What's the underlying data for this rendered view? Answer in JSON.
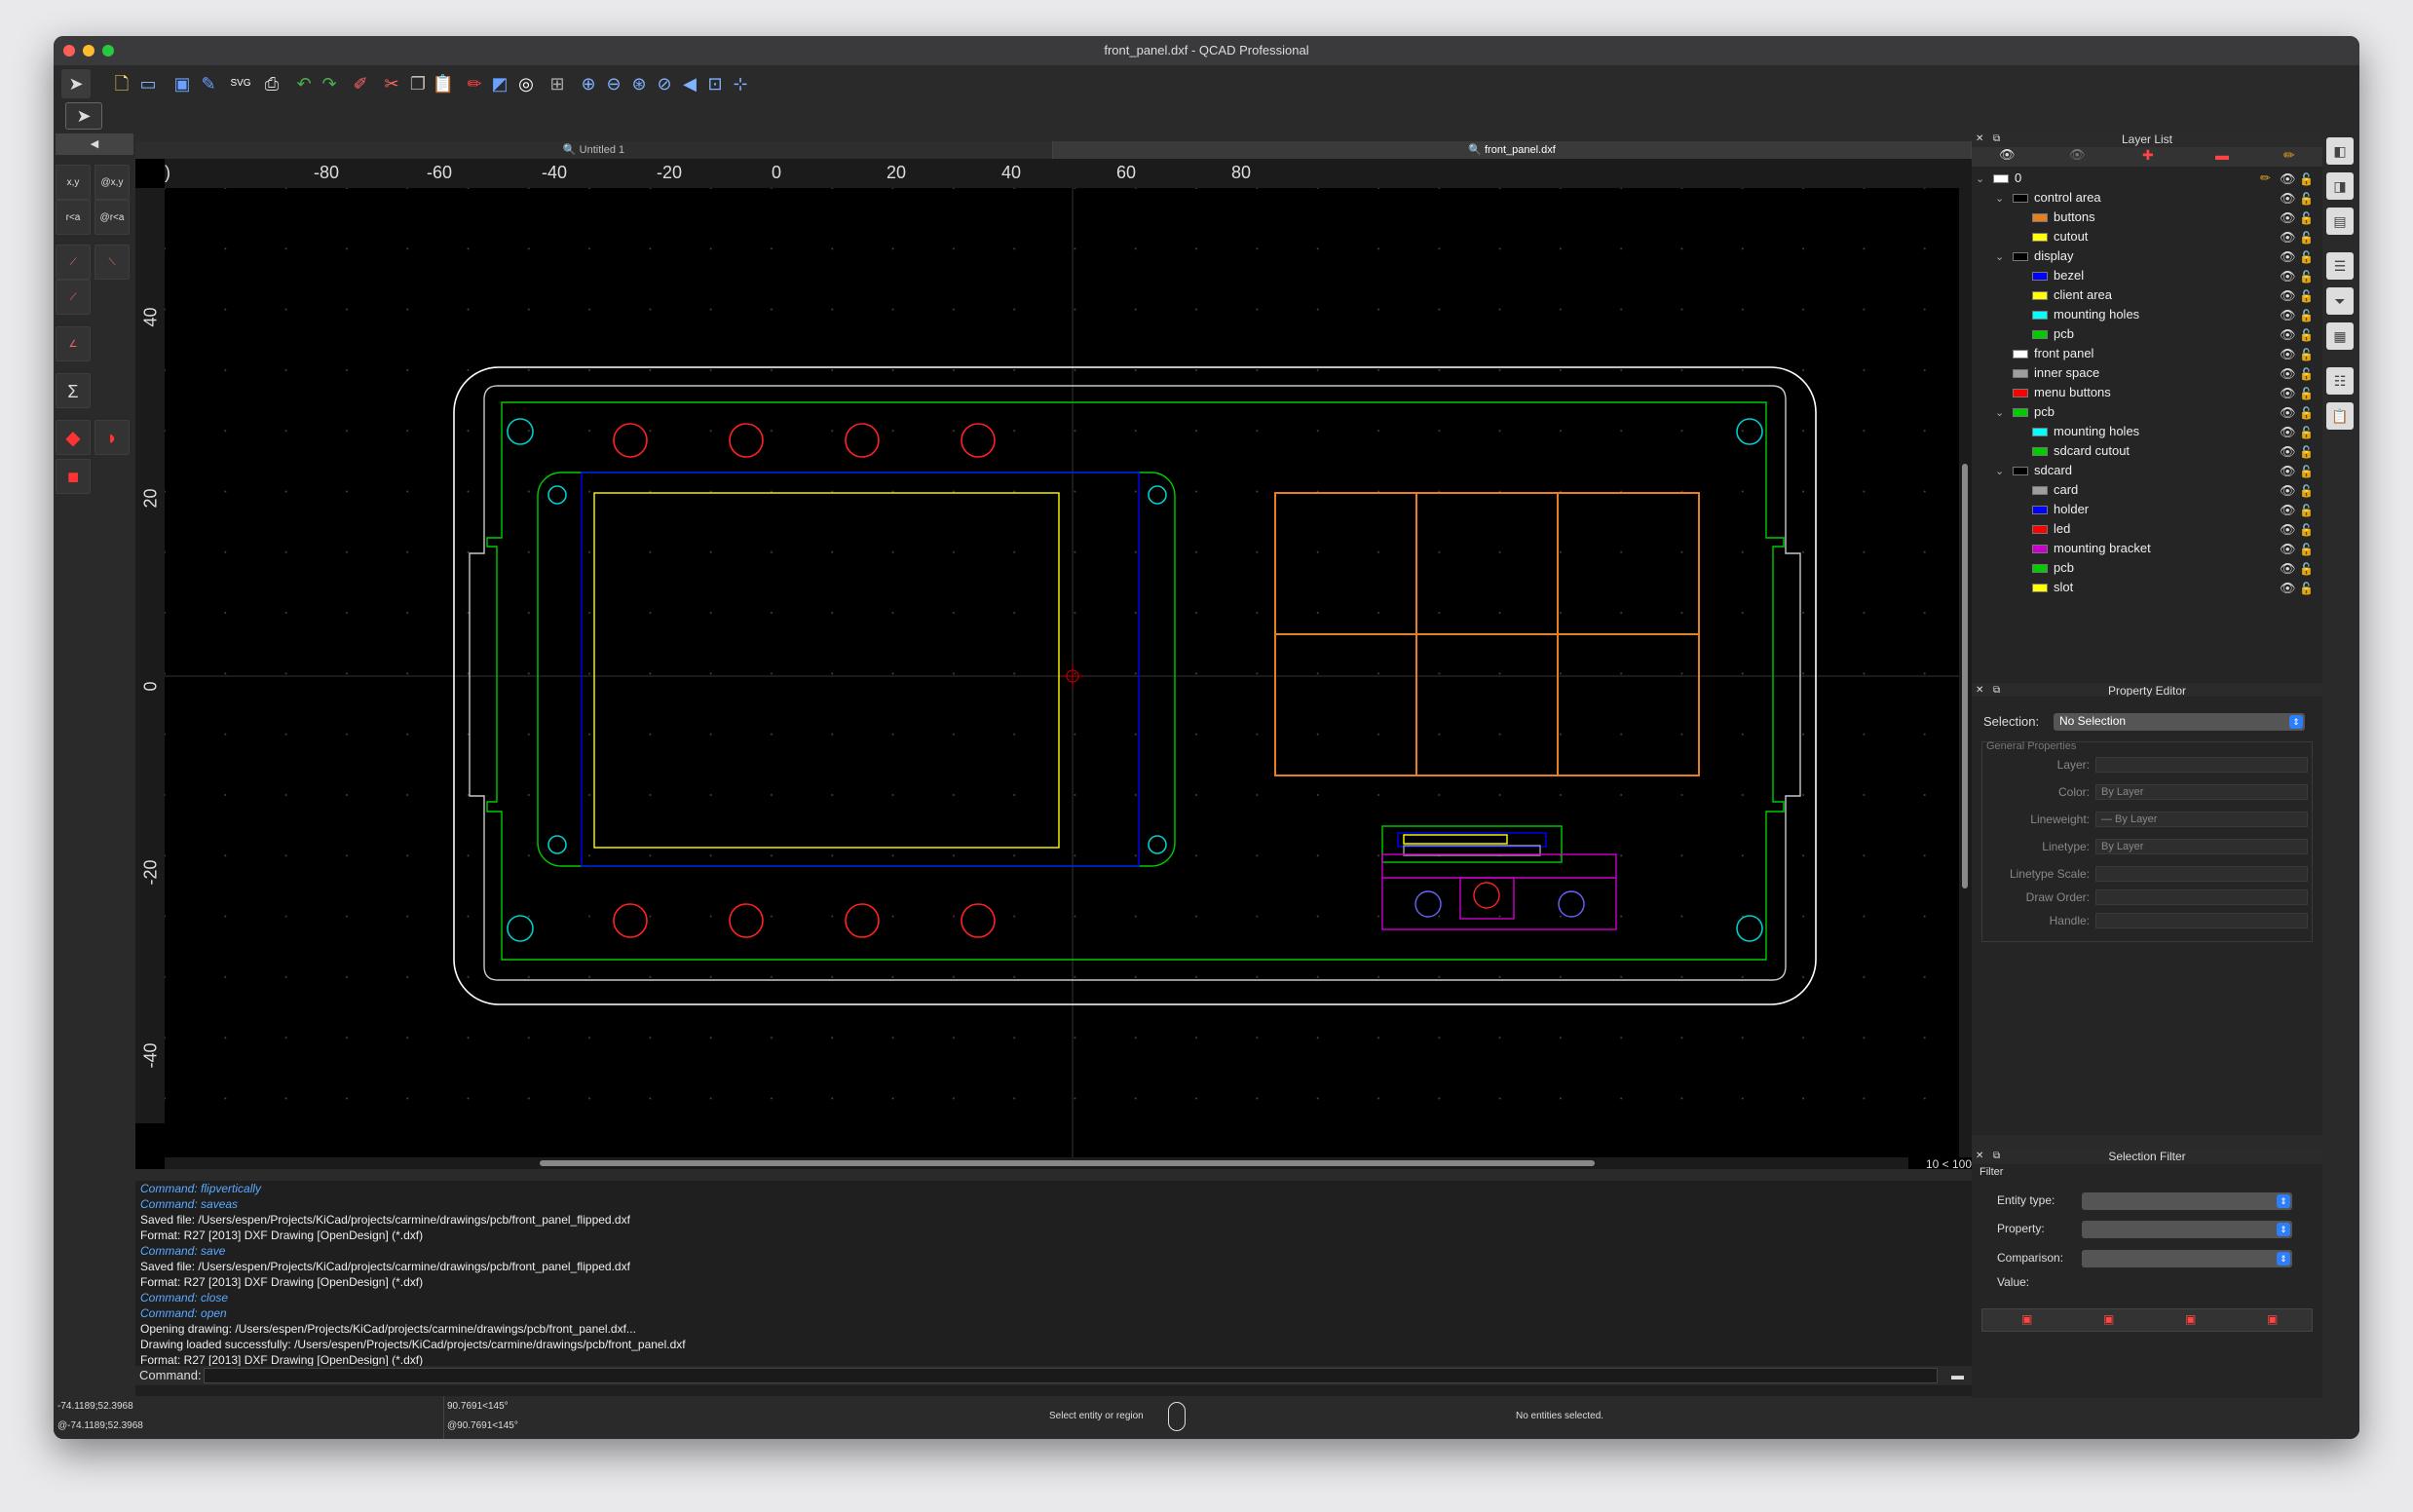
{
  "window": {
    "title": "front_panel.dxf - QCAD Professional"
  },
  "toolbar": {
    "icons": [
      "pointer-icon",
      "new-file-icon",
      "open-icon",
      "save-icon",
      "edit-icon",
      "svg-export-icon",
      "print-icon",
      "undo-icon",
      "redo-icon",
      "eraser-icon",
      "cut-icon",
      "copy-icon",
      "paste-icon",
      "pen-icon",
      "block-icon",
      "circle-tool-icon",
      "grid-icon",
      "zoom-in-icon",
      "zoom-out-icon",
      "zoom-auto-icon",
      "zoom-previous-icon",
      "zoom-pan-icon",
      "zoom-window-icon",
      "zoom-selection-icon"
    ],
    "svg_label": "SVG"
  },
  "left_tools": {
    "xy": "x,y",
    "rel_xy": "@x,y",
    "polar": "r<a",
    "rel_polar": "@r<a",
    "sigma": "Σ"
  },
  "tabs": [
    {
      "label": "Untitled 1",
      "active": false
    },
    {
      "label": "front_panel.dxf",
      "active": true
    }
  ],
  "rulers": {
    "horizontal": [
      "-80",
      "-60",
      "-40",
      "-20",
      "0",
      "20",
      "40",
      "60",
      "80"
    ],
    "vertical": [
      "40",
      "20",
      "0",
      "-20",
      "-40"
    ]
  },
  "zoom_label": "10 < 100",
  "console": {
    "lines": [
      {
        "text": "Command: flipvertically",
        "cmd": true
      },
      {
        "text": "Command: saveas",
        "cmd": true
      },
      {
        "text": "Saved file: /Users/espen/Projects/KiCad/projects/carmine/drawings/pcb/front_panel_flipped.dxf",
        "cmd": false
      },
      {
        "text": "Format: R27 [2013] DXF Drawing [OpenDesign] (*.dxf)",
        "cmd": false
      },
      {
        "text": "Command: save",
        "cmd": true
      },
      {
        "text": "Saved file: /Users/espen/Projects/KiCad/projects/carmine/drawings/pcb/front_panel_flipped.dxf",
        "cmd": false
      },
      {
        "text": "Format: R27 [2013] DXF Drawing [OpenDesign] (*.dxf)",
        "cmd": false
      },
      {
        "text": "Command: close",
        "cmd": true
      },
      {
        "text": "Command: open",
        "cmd": true
      },
      {
        "text": "Opening drawing: /Users/espen/Projects/KiCad/projects/carmine/drawings/pcb/front_panel.dxf...",
        "cmd": false
      },
      {
        "text": "Drawing loaded successfully: /Users/espen/Projects/KiCad/projects/carmine/drawings/pcb/front_panel.dxf",
        "cmd": false
      },
      {
        "text": "Format: R27 [2013] DXF Drawing [OpenDesign] (*.dxf)",
        "cmd": false
      }
    ],
    "command_label": "Command:"
  },
  "status": {
    "abs_coord": "-74.1189;52.3968",
    "rel_coord": "@-74.1189;52.3968",
    "polar_coord": "90.7691<145°",
    "rel_polar_coord": "@90.7691<145°",
    "hint": "Select entity or region",
    "selection": "No entities selected."
  },
  "layer_list": {
    "title": "Layer List",
    "layers": [
      {
        "name": "0",
        "color": "#ffffff",
        "depth": 0,
        "toggle": "⌄"
      },
      {
        "name": "control area",
        "color": "#000000",
        "depth": 1,
        "toggle": "⌄"
      },
      {
        "name": "buttons",
        "color": "#e67f22",
        "depth": 2,
        "toggle": ""
      },
      {
        "name": "cutout",
        "color": "#ffff00",
        "depth": 2,
        "toggle": ""
      },
      {
        "name": "display",
        "color": "#000000",
        "depth": 1,
        "toggle": "⌄"
      },
      {
        "name": "bezel",
        "color": "#0000ff",
        "depth": 2,
        "toggle": ""
      },
      {
        "name": "client area",
        "color": "#ffff00",
        "depth": 2,
        "toggle": ""
      },
      {
        "name": "mounting holes",
        "color": "#00ffff",
        "depth": 2,
        "toggle": ""
      },
      {
        "name": "pcb",
        "color": "#00cc00",
        "depth": 2,
        "toggle": ""
      },
      {
        "name": "front panel",
        "color": "#ffffff",
        "depth": 1,
        "toggle": ""
      },
      {
        "name": "inner space",
        "color": "#9e9e9e",
        "depth": 1,
        "toggle": ""
      },
      {
        "name": "menu buttons",
        "color": "#ff0000",
        "depth": 1,
        "toggle": ""
      },
      {
        "name": "pcb",
        "color": "#00cc00",
        "depth": 1,
        "toggle": "⌄"
      },
      {
        "name": "mounting holes",
        "color": "#00ffff",
        "depth": 2,
        "toggle": ""
      },
      {
        "name": "sdcard cutout",
        "color": "#00cc00",
        "depth": 2,
        "toggle": ""
      },
      {
        "name": "sdcard",
        "color": "#000000",
        "depth": 1,
        "toggle": "⌄"
      },
      {
        "name": "card",
        "color": "#9e9e9e",
        "depth": 2,
        "toggle": ""
      },
      {
        "name": "holder",
        "color": "#0000ff",
        "depth": 2,
        "toggle": ""
      },
      {
        "name": "led",
        "color": "#ff0000",
        "depth": 2,
        "toggle": ""
      },
      {
        "name": "mounting bracket",
        "color": "#cc00cc",
        "depth": 2,
        "toggle": ""
      },
      {
        "name": "pcb",
        "color": "#00cc00",
        "depth": 2,
        "toggle": ""
      },
      {
        "name": "slot",
        "color": "#ffff00",
        "depth": 2,
        "toggle": ""
      }
    ]
  },
  "property_editor": {
    "title": "Property Editor",
    "selection_label": "Selection:",
    "selection_value": "No Selection",
    "group_label": "General Properties",
    "fields": [
      {
        "label": "Layer:",
        "value": ""
      },
      {
        "label": "Color:",
        "value": "By Layer"
      },
      {
        "label": "Lineweight:",
        "value": "— By Layer"
      },
      {
        "label": "Linetype:",
        "value": "By Layer"
      },
      {
        "label": "Linetype Scale:",
        "value": ""
      },
      {
        "label": "Draw Order:",
        "value": ""
      },
      {
        "label": "Handle:",
        "value": ""
      }
    ]
  },
  "selection_filter": {
    "title": "Selection Filter",
    "group_label": "Filter",
    "entity_type_label": "Entity type:",
    "property_label": "Property:",
    "comparison_label": "Comparison:",
    "value_label": "Value:"
  }
}
